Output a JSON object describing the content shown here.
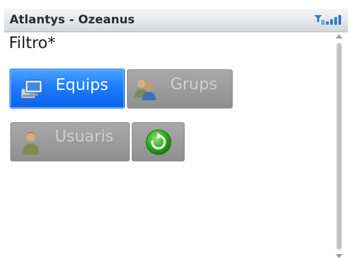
{
  "titlebar": {
    "title": "Atlantys - Ozeanus",
    "signal_icon": "signal-strength-icon"
  },
  "heading": "Filtro*",
  "buttons": {
    "equips": {
      "label": "Equips",
      "icon": "computer-icon",
      "selected": true
    },
    "grups": {
      "label": "Grups",
      "icon": "group-users-icon",
      "selected": false
    },
    "usuaris": {
      "label": "Usuaris",
      "icon": "user-icon",
      "selected": false
    },
    "refresh": {
      "label": "",
      "icon": "refresh-icon",
      "selected": false
    }
  },
  "colors": {
    "selected_button": "#1d7dff",
    "inactive_button": "#9c9c9c",
    "refresh_green": "#2fae1f"
  }
}
